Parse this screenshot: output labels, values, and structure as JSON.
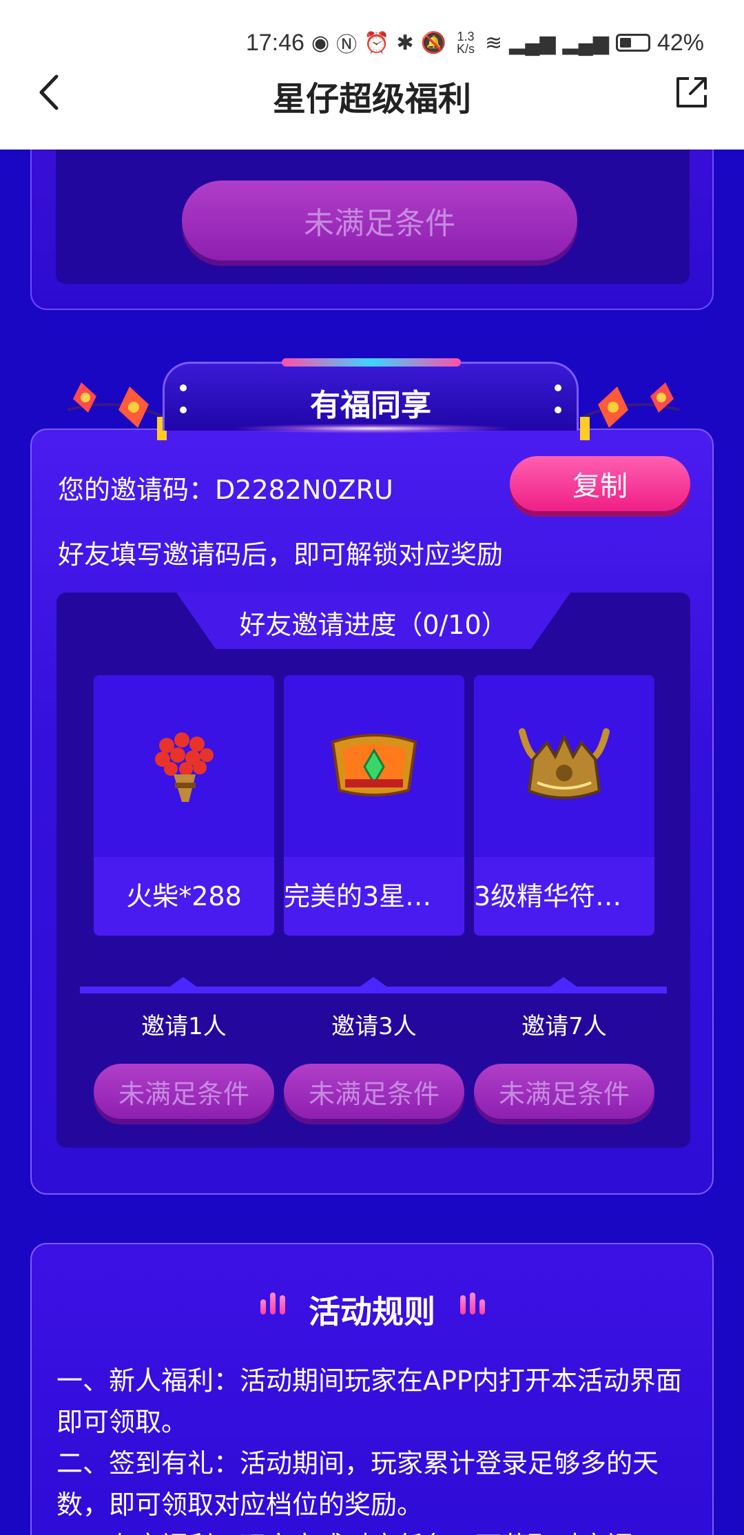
{
  "status_bar": {
    "time": "17:46",
    "net_speed": "1.3 K/s",
    "battery_pct": "42%",
    "icons": [
      "eye-icon",
      "nfc-icon",
      "alarm-icon",
      "bluetooth-icon",
      "mute-icon",
      "wifi-icon",
      "signal-icon",
      "signal-icon",
      "battery-icon"
    ]
  },
  "header": {
    "title": "星仔超级福利",
    "back_icon": "chevron-left-icon",
    "share_icon": "external-link-icon"
  },
  "top_card": {
    "button_label": "未满足条件"
  },
  "share_section": {
    "banner_title": "有福同享",
    "invite_label": "您的邀请码：",
    "invite_code": "D2282N0ZRU",
    "copy_label": "复制",
    "hint": "好友填写邀请码后，即可解锁对应奖励",
    "progress_title": "好友邀请进度（0/10）",
    "progress": {
      "invited": 0,
      "target": 10
    },
    "rewards": [
      {
        "name": "火柴*288",
        "step": "邀请1人",
        "button": "未满足条件",
        "icon": "matches-bouquet-icon"
      },
      {
        "name": "完美的3星…",
        "step": "邀请3人",
        "button": "未满足条件",
        "icon": "golden-gem-crown-icon"
      },
      {
        "name": "3级精华符…",
        "step": "邀请7人",
        "button": "未满足条件",
        "icon": "horned-gold-crown-icon"
      }
    ]
  },
  "rules": {
    "title": "活动规则",
    "lines": [
      "一、新人福利：活动期间玩家在APP内打开本活动界面即可领取。",
      "二、签到有礼：活动期间，玩家累计登录足够多的天数，即可领取对应档位的奖励。",
      "三、有享福利：玩家完成对应任务，可获取对应福"
    ]
  },
  "colors": {
    "page_bg": "#1a07c4",
    "accent_pink": "#ef1f86",
    "disabled_button": "#9a2bbf"
  }
}
